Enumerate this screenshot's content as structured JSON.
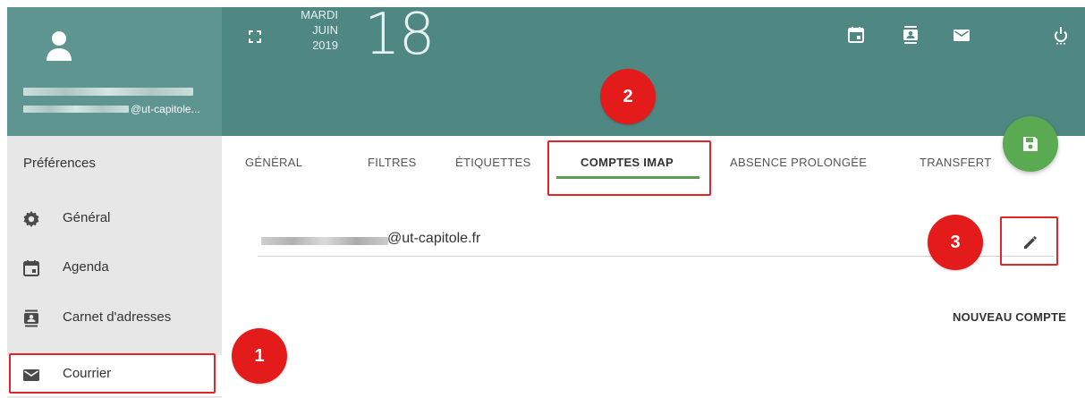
{
  "user": {
    "email_suffix": "@ut-capitole..."
  },
  "header": {
    "day_name": "MARDI",
    "month": "JUIN",
    "year": "2019",
    "day_number": "18",
    "icons": [
      "fullscreen-icon",
      "calendar-icon",
      "contacts-icon",
      "mail-icon",
      "power-icon"
    ]
  },
  "sidebar": {
    "title": "Préférences",
    "items": [
      {
        "label": "Général",
        "icon": "gear-icon"
      },
      {
        "label": "Agenda",
        "icon": "calendar-icon"
      },
      {
        "label": "Carnet d'adresses",
        "icon": "contacts-icon"
      },
      {
        "label": "Courrier",
        "icon": "mail-icon",
        "active": true
      }
    ]
  },
  "tabs": [
    {
      "label": "GÉNÉRAL"
    },
    {
      "label": "FILTRES"
    },
    {
      "label": "ÉTIQUETTES"
    },
    {
      "label": "COMPTES IMAP",
      "active": true
    },
    {
      "label": "ABSENCE PROLONGÉE"
    },
    {
      "label": "TRANSFERT"
    }
  ],
  "account": {
    "email_suffix": "@ut-capitole.fr"
  },
  "actions": {
    "new_account": "NOUVEAU COMPTE",
    "save_icon": "save-icon",
    "edit_icon": "pencil-icon"
  },
  "callouts": [
    "1",
    "2",
    "3"
  ],
  "colors": {
    "header": "#4f8783",
    "user_box": "#5f9591",
    "accent_green": "#5aaa51",
    "callout_red": "#e41b1b"
  }
}
